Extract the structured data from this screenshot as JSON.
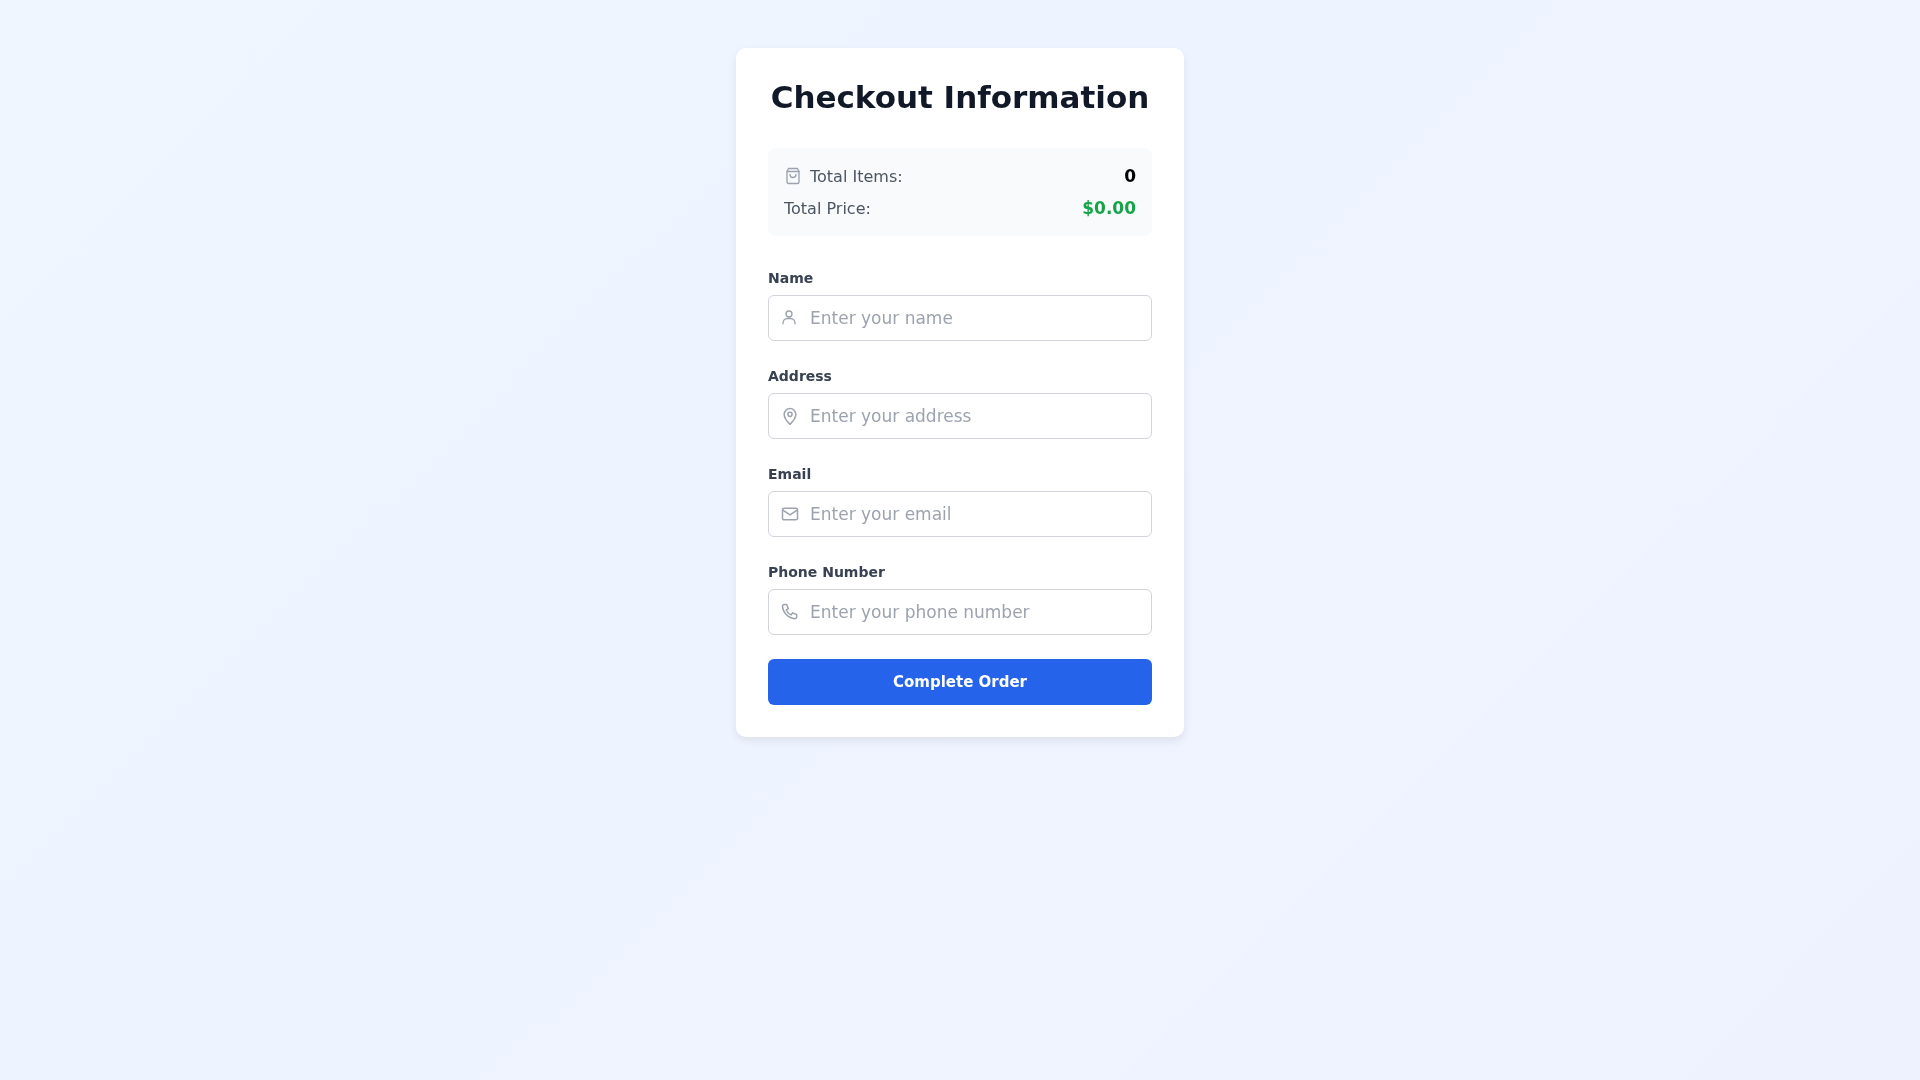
{
  "title": "Checkout Information",
  "summary": [
    {
      "label": "Total Items:",
      "value": "0",
      "kind": "count"
    },
    {
      "label": "Total Price:",
      "value": "$0.00",
      "kind": "price"
    }
  ],
  "fields": [
    {
      "label": "Name",
      "placeholder": "Enter your name",
      "kind": "person"
    },
    {
      "label": "Address",
      "placeholder": "Enter your address",
      "kind": "pin"
    },
    {
      "label": "Email",
      "placeholder": "Enter your email",
      "kind": "mail"
    },
    {
      "label": "Phone Number",
      "placeholder": "Enter your phone number",
      "kind": "phone"
    }
  ],
  "button": "Complete Order"
}
